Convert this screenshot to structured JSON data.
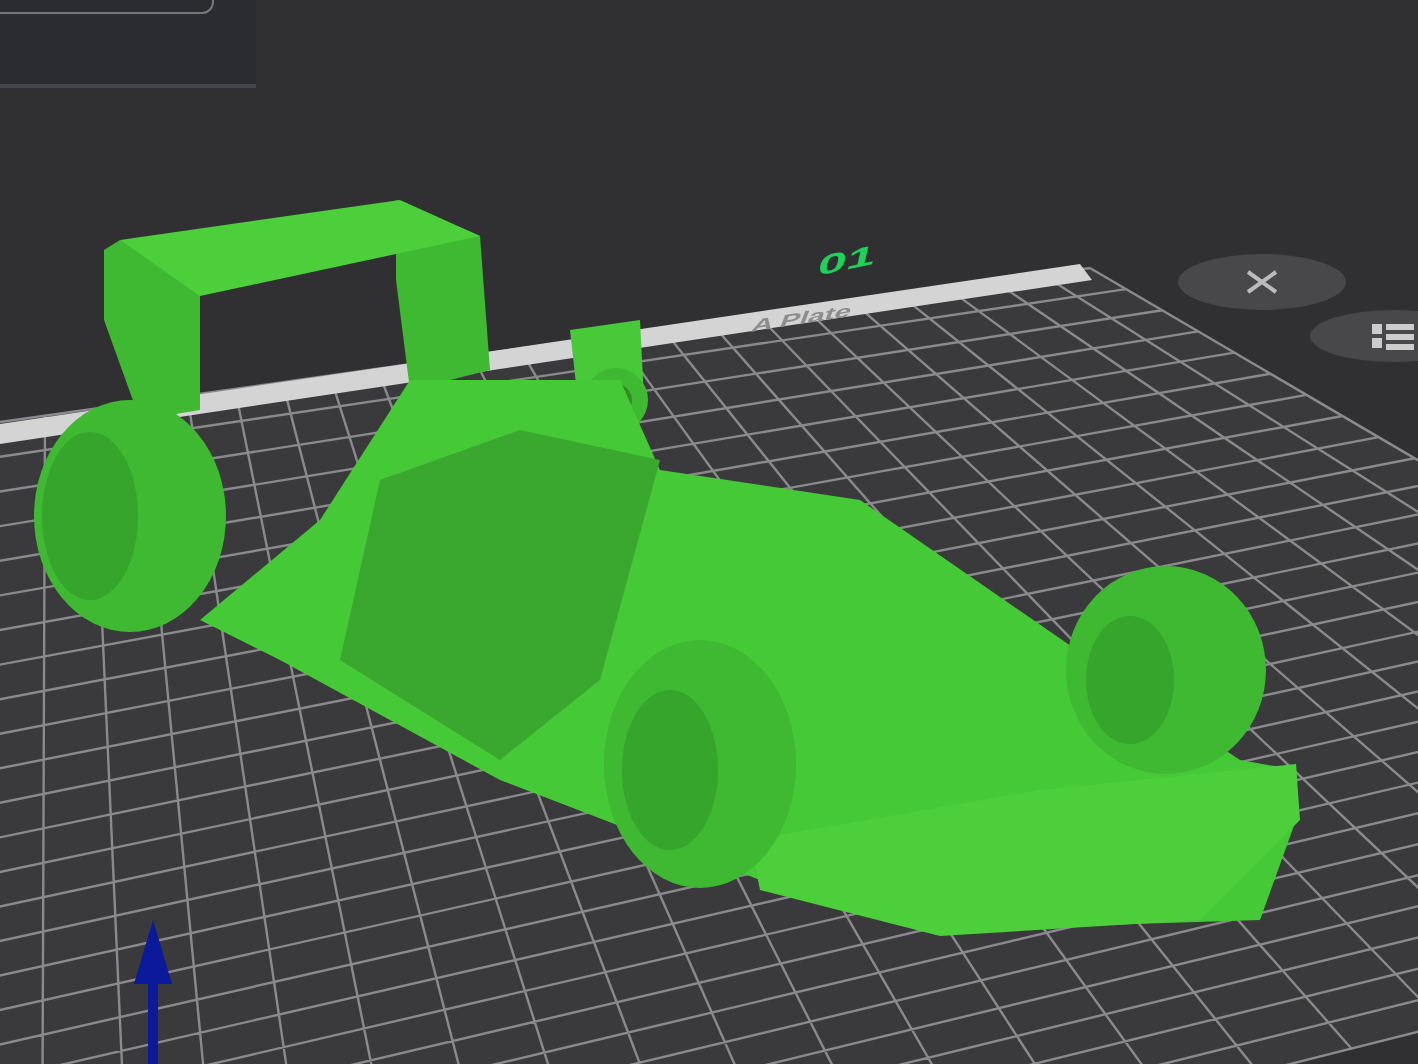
{
  "plate": {
    "number": "01",
    "name": "A Plate"
  }
}
